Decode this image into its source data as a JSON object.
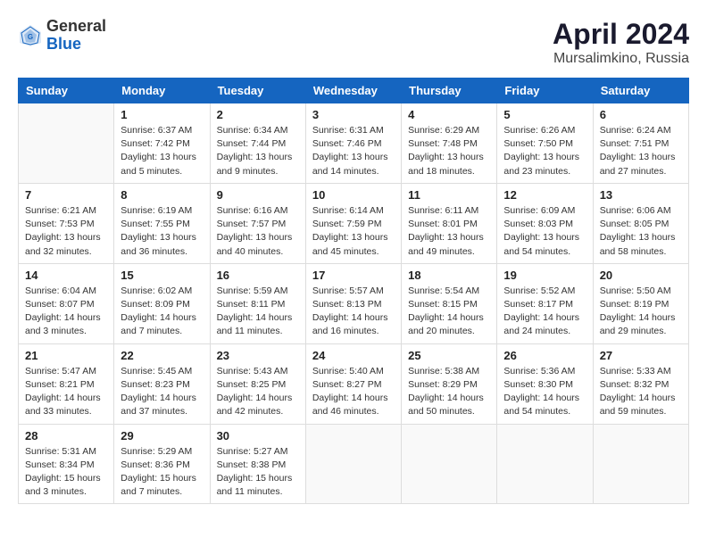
{
  "header": {
    "logo_general": "General",
    "logo_blue": "Blue",
    "title": "April 2024",
    "subtitle": "Mursalimkino, Russia"
  },
  "weekdays": [
    "Sunday",
    "Monday",
    "Tuesday",
    "Wednesday",
    "Thursday",
    "Friday",
    "Saturday"
  ],
  "weeks": [
    [
      {
        "day": "",
        "info": ""
      },
      {
        "day": "1",
        "info": "Sunrise: 6:37 AM\nSunset: 7:42 PM\nDaylight: 13 hours\nand 5 minutes."
      },
      {
        "day": "2",
        "info": "Sunrise: 6:34 AM\nSunset: 7:44 PM\nDaylight: 13 hours\nand 9 minutes."
      },
      {
        "day": "3",
        "info": "Sunrise: 6:31 AM\nSunset: 7:46 PM\nDaylight: 13 hours\nand 14 minutes."
      },
      {
        "day": "4",
        "info": "Sunrise: 6:29 AM\nSunset: 7:48 PM\nDaylight: 13 hours\nand 18 minutes."
      },
      {
        "day": "5",
        "info": "Sunrise: 6:26 AM\nSunset: 7:50 PM\nDaylight: 13 hours\nand 23 minutes."
      },
      {
        "day": "6",
        "info": "Sunrise: 6:24 AM\nSunset: 7:51 PM\nDaylight: 13 hours\nand 27 minutes."
      }
    ],
    [
      {
        "day": "7",
        "info": "Sunrise: 6:21 AM\nSunset: 7:53 PM\nDaylight: 13 hours\nand 32 minutes."
      },
      {
        "day": "8",
        "info": "Sunrise: 6:19 AM\nSunset: 7:55 PM\nDaylight: 13 hours\nand 36 minutes."
      },
      {
        "day": "9",
        "info": "Sunrise: 6:16 AM\nSunset: 7:57 PM\nDaylight: 13 hours\nand 40 minutes."
      },
      {
        "day": "10",
        "info": "Sunrise: 6:14 AM\nSunset: 7:59 PM\nDaylight: 13 hours\nand 45 minutes."
      },
      {
        "day": "11",
        "info": "Sunrise: 6:11 AM\nSunset: 8:01 PM\nDaylight: 13 hours\nand 49 minutes."
      },
      {
        "day": "12",
        "info": "Sunrise: 6:09 AM\nSunset: 8:03 PM\nDaylight: 13 hours\nand 54 minutes."
      },
      {
        "day": "13",
        "info": "Sunrise: 6:06 AM\nSunset: 8:05 PM\nDaylight: 13 hours\nand 58 minutes."
      }
    ],
    [
      {
        "day": "14",
        "info": "Sunrise: 6:04 AM\nSunset: 8:07 PM\nDaylight: 14 hours\nand 3 minutes."
      },
      {
        "day": "15",
        "info": "Sunrise: 6:02 AM\nSunset: 8:09 PM\nDaylight: 14 hours\nand 7 minutes."
      },
      {
        "day": "16",
        "info": "Sunrise: 5:59 AM\nSunset: 8:11 PM\nDaylight: 14 hours\nand 11 minutes."
      },
      {
        "day": "17",
        "info": "Sunrise: 5:57 AM\nSunset: 8:13 PM\nDaylight: 14 hours\nand 16 minutes."
      },
      {
        "day": "18",
        "info": "Sunrise: 5:54 AM\nSunset: 8:15 PM\nDaylight: 14 hours\nand 20 minutes."
      },
      {
        "day": "19",
        "info": "Sunrise: 5:52 AM\nSunset: 8:17 PM\nDaylight: 14 hours\nand 24 minutes."
      },
      {
        "day": "20",
        "info": "Sunrise: 5:50 AM\nSunset: 8:19 PM\nDaylight: 14 hours\nand 29 minutes."
      }
    ],
    [
      {
        "day": "21",
        "info": "Sunrise: 5:47 AM\nSunset: 8:21 PM\nDaylight: 14 hours\nand 33 minutes."
      },
      {
        "day": "22",
        "info": "Sunrise: 5:45 AM\nSunset: 8:23 PM\nDaylight: 14 hours\nand 37 minutes."
      },
      {
        "day": "23",
        "info": "Sunrise: 5:43 AM\nSunset: 8:25 PM\nDaylight: 14 hours\nand 42 minutes."
      },
      {
        "day": "24",
        "info": "Sunrise: 5:40 AM\nSunset: 8:27 PM\nDaylight: 14 hours\nand 46 minutes."
      },
      {
        "day": "25",
        "info": "Sunrise: 5:38 AM\nSunset: 8:29 PM\nDaylight: 14 hours\nand 50 minutes."
      },
      {
        "day": "26",
        "info": "Sunrise: 5:36 AM\nSunset: 8:30 PM\nDaylight: 14 hours\nand 54 minutes."
      },
      {
        "day": "27",
        "info": "Sunrise: 5:33 AM\nSunset: 8:32 PM\nDaylight: 14 hours\nand 59 minutes."
      }
    ],
    [
      {
        "day": "28",
        "info": "Sunrise: 5:31 AM\nSunset: 8:34 PM\nDaylight: 15 hours\nand 3 minutes."
      },
      {
        "day": "29",
        "info": "Sunrise: 5:29 AM\nSunset: 8:36 PM\nDaylight: 15 hours\nand 7 minutes."
      },
      {
        "day": "30",
        "info": "Sunrise: 5:27 AM\nSunset: 8:38 PM\nDaylight: 15 hours\nand 11 minutes."
      },
      {
        "day": "",
        "info": ""
      },
      {
        "day": "",
        "info": ""
      },
      {
        "day": "",
        "info": ""
      },
      {
        "day": "",
        "info": ""
      }
    ]
  ]
}
